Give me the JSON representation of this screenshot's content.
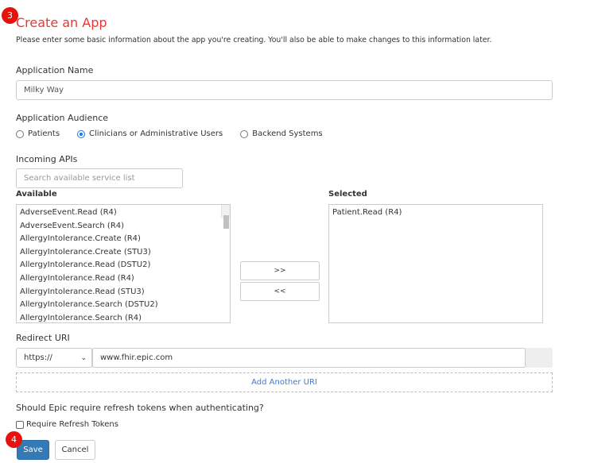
{
  "badges": {
    "step3": "3",
    "step4": "4"
  },
  "title": "Create an App",
  "description": "Please enter some basic information about the app you're creating. You'll also be able to make changes to this information later.",
  "app_name": {
    "label": "Application Name",
    "value": "Milky Way"
  },
  "audience": {
    "label": "Application Audience",
    "options": [
      "Patients",
      "Clinicians or Administrative Users",
      "Backend Systems"
    ],
    "selected": "Clinicians or Administrative Users"
  },
  "apis": {
    "label": "Incoming APIs",
    "search_placeholder": "Search available service list",
    "available_label": "Available",
    "selected_label": "Selected",
    "available": [
      "AdverseEvent.Read (R4)",
      "AdverseEvent.Search (R4)",
      "AllergyIntolerance.Create (R4)",
      "AllergyIntolerance.Create (STU3)",
      "AllergyIntolerance.Read (DSTU2)",
      "AllergyIntolerance.Read (R4)",
      "AllergyIntolerance.Read (STU3)",
      "AllergyIntolerance.Search (DSTU2)",
      "AllergyIntolerance.Search (R4)"
    ],
    "selected": [
      "Patient.Read (R4)"
    ],
    "add_label": ">>",
    "remove_label": "<<"
  },
  "redirect": {
    "label": "Redirect URI",
    "scheme": "https://",
    "value": "www.fhir.epic.com",
    "add_label": "Add Another URI"
  },
  "refresh": {
    "question": "Should Epic require refresh tokens when authenticating?",
    "checkbox_label": "Require Refresh Tokens",
    "checked": false
  },
  "actions": {
    "save": "Save",
    "cancel": "Cancel"
  },
  "colors": {
    "accent": "#337ab7",
    "title": "#e53935",
    "badge": "#e8120c",
    "link": "#3c78d8"
  }
}
